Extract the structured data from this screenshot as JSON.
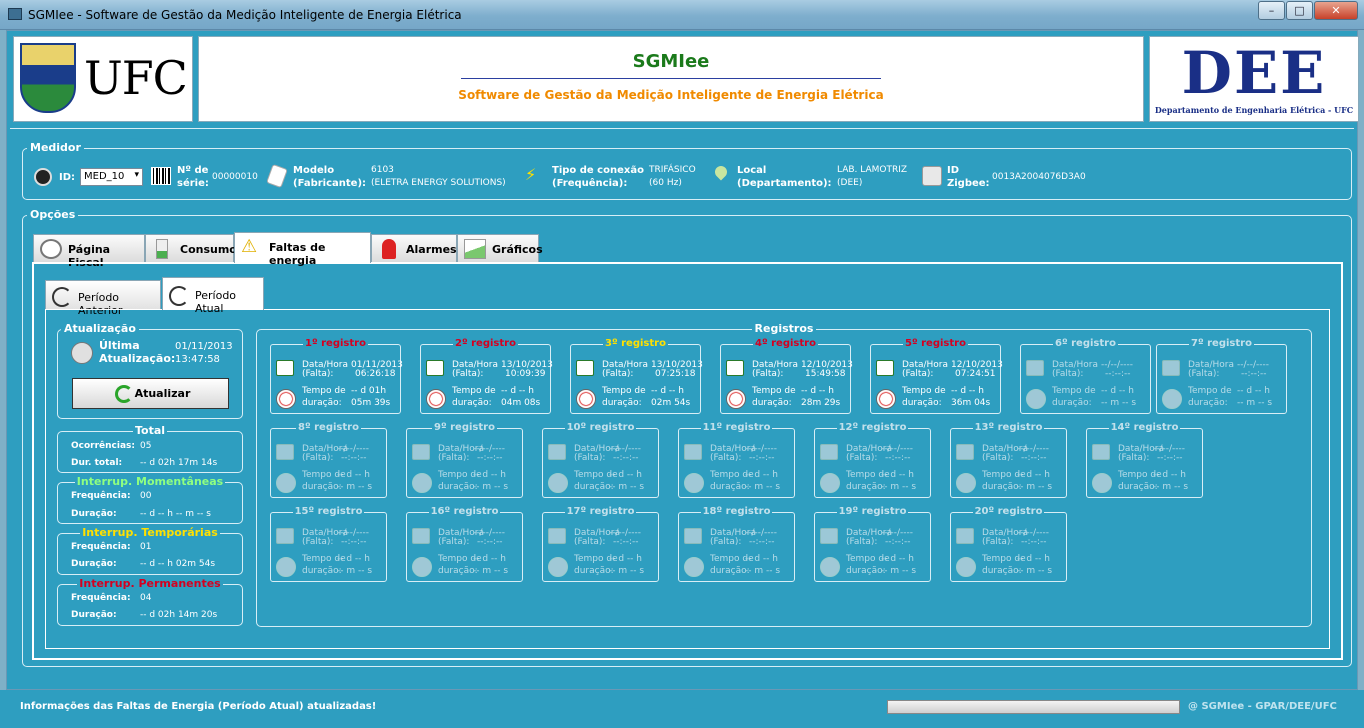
{
  "window": {
    "title": "SGMIee - Software de Gestão da Medição Inteligente de Energia Elétrica",
    "min": "–",
    "max": "□",
    "close": "✕"
  },
  "header": {
    "ufc_text": "UFC",
    "app_name": "SGMIee",
    "app_subtitle": "Software de Gestão da Medição Inteligente de Energia Elétrica",
    "dee_text": "DEE",
    "dee_subtitle": "Departamento de Engenharia Elétrica - UFC"
  },
  "medidor": {
    "section_title": "Medidor",
    "id_label": "ID:",
    "id_value": "MED_10",
    "serie_label1": "Nº de",
    "serie_label2": "série:",
    "serie_value": "00000010",
    "modelo_label1": "Modelo",
    "modelo_label2": "(Fabricante):",
    "modelo_value1": "6103",
    "modelo_value2": "(ELETRA ENERGY SOLUTIONS)",
    "conexao_label1": "Tipo de conexão",
    "conexao_label2": "(Frequência):",
    "conexao_value1": "TRIFÁSICO",
    "conexao_value2": "(60 Hz)",
    "local_label1": "Local",
    "local_label2": "(Departamento):",
    "local_value1": "LAB. LAMOTRIZ",
    "local_value2": "(DEE)",
    "zigbee_label1": "ID",
    "zigbee_label2": "Zigbee:",
    "zigbee_value": "0013A2004076D3A0"
  },
  "opcoes": {
    "section_title": "Opções",
    "tabs": [
      "Página Fiscal",
      "Consumo",
      "Faltas de energia",
      "Alarmes",
      "Gráficos"
    ],
    "subtabs": [
      "Período Anterior",
      "Período Atual"
    ]
  },
  "atualizacao": {
    "title": "Atualização",
    "ultima_label1": "Última",
    "ultima_label2": "Atualização:",
    "date": "01/11/2013",
    "time": "13:47:58",
    "button": "Atualizar"
  },
  "total": {
    "title": "Total",
    "ocorr_label": "Ocorrências:",
    "ocorr_value": "05",
    "dur_label": "Dur. total:",
    "dur_value": "-- d 02h 17m 14s"
  },
  "momentaneas": {
    "title": "Interrup. Momentâneas",
    "freq_label": "Frequência:",
    "freq_value": "00",
    "dur_label": "Duração:",
    "dur_value": "-- d -- h -- m -- s"
  },
  "temporarias": {
    "title": "Interrup. Temporárias",
    "freq_label": "Frequência:",
    "freq_value": "01",
    "dur_label": "Duração:",
    "dur_value": "-- d -- h 02m 54s"
  },
  "permanentes": {
    "title": "Interrup. Permanentes",
    "freq_label": "Frequência:",
    "freq_value": "04",
    "dur_label": "Duração:",
    "dur_value": "-- d 02h 14m 20s"
  },
  "registros": {
    "title": "Registros",
    "lbl_dh1": "Data/Hora",
    "lbl_dh2": "(Falta):",
    "lbl_t1": "Tempo de",
    "lbl_t2": "duração:",
    "items": [
      {
        "title": "1º registro",
        "color": "#d40020",
        "date": "01/11/2013",
        "time": "06:26:18",
        "d1": "-- d 01h",
        "d2": "05m 39s"
      },
      {
        "title": "2º registro",
        "color": "#d40020",
        "date": "13/10/2013",
        "time": "10:09:39",
        "d1": "-- d -- h",
        "d2": "04m 08s"
      },
      {
        "title": "3º registro",
        "color": "#ffe000",
        "date": "13/10/2013",
        "time": "07:25:18",
        "d1": "-- d -- h",
        "d2": "02m 54s"
      },
      {
        "title": "4º registro",
        "color": "#d40020",
        "date": "12/10/2013",
        "time": "15:49:58",
        "d1": "-- d -- h",
        "d2": "28m 29s"
      },
      {
        "title": "5º registro",
        "color": "#d40020",
        "date": "12/10/2013",
        "time": "07:24:51",
        "d1": "-- d -- h",
        "d2": "36m 04s"
      },
      {
        "title": "6º registro",
        "date": "--/--/----",
        "time": "--:--:--",
        "d1": "-- d -- h",
        "d2": "-- m -- s"
      },
      {
        "title": "7º registro",
        "date": "--/--/----",
        "time": "--:--:--",
        "d1": "-- d -- h",
        "d2": "-- m -- s"
      },
      {
        "title": "8º registro",
        "date": "--/--/----",
        "time": "--:--:--",
        "d1": "-- d -- h",
        "d2": "-- m -- s"
      },
      {
        "title": "9º registro",
        "date": "--/--/----",
        "time": "--:--:--",
        "d1": "-- d -- h",
        "d2": "-- m -- s"
      },
      {
        "title": "10º registro",
        "date": "--/--/----",
        "time": "--:--:--",
        "d1": "-- d -- h",
        "d2": "-- m -- s"
      },
      {
        "title": "11º registro",
        "date": "--/--/----",
        "time": "--:--:--",
        "d1": "-- d -- h",
        "d2": "-- m -- s"
      },
      {
        "title": "12º registro",
        "date": "--/--/----",
        "time": "--:--:--",
        "d1": "-- d -- h",
        "d2": "-- m -- s"
      },
      {
        "title": "13º registro",
        "date": "--/--/----",
        "time": "--:--:--",
        "d1": "-- d -- h",
        "d2": "-- m -- s"
      },
      {
        "title": "14º registro",
        "date": "--/--/----",
        "time": "--:--:--",
        "d1": "-- d -- h",
        "d2": "-- m -- s"
      },
      {
        "title": "15º registro",
        "date": "--/--/----",
        "time": "--:--:--",
        "d1": "-- d -- h",
        "d2": "-- m -- s"
      },
      {
        "title": "16º registro",
        "date": "--/--/----",
        "time": "--:--:--",
        "d1": "-- d -- h",
        "d2": "-- m -- s"
      },
      {
        "title": "17º registro",
        "date": "--/--/----",
        "time": "--:--:--",
        "d1": "-- d -- h",
        "d2": "-- m -- s"
      },
      {
        "title": "18º registro",
        "date": "--/--/----",
        "time": "--:--:--",
        "d1": "-- d -- h",
        "d2": "-- m -- s"
      },
      {
        "title": "19º registro",
        "date": "--/--/----",
        "time": "--:--:--",
        "d1": "-- d -- h",
        "d2": "-- m -- s"
      },
      {
        "title": "20º registro",
        "date": "--/--/----",
        "time": "--:--:--",
        "d1": "-- d -- h",
        "d2": "-- m -- s"
      }
    ]
  },
  "status": {
    "message": "Informações das Faltas de Energia (Período Atual) atualizadas!",
    "copyright": "@ SGMIee - GPAR/DEE/UFC"
  }
}
